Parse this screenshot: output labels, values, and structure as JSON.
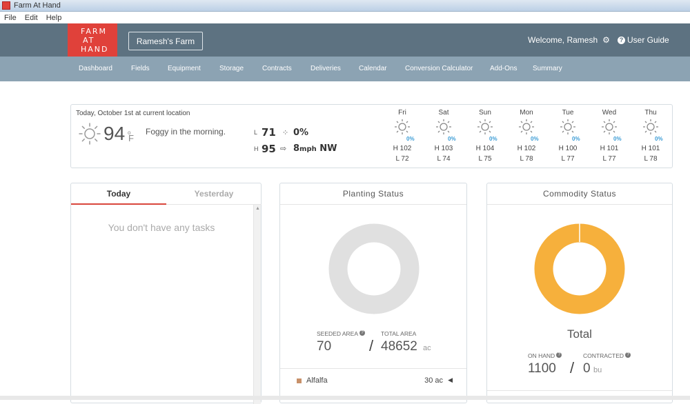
{
  "window": {
    "title": "Farm At Hand"
  },
  "menu": [
    "File",
    "Edit",
    "Help"
  ],
  "header": {
    "logo_lines": [
      "FARM",
      "AT",
      "HAND"
    ],
    "farm_name": "Ramesh's Farm",
    "welcome": "Welcome, Ramesh",
    "user_guide": "User Guide"
  },
  "nav": [
    "Dashboard",
    "Fields",
    "Equipment",
    "Storage",
    "Contracts",
    "Deliveries",
    "Calendar",
    "Conversion Calculator",
    "Add-Ons",
    "Summary"
  ],
  "weather": {
    "date_line": "Today, October 1st at current location",
    "temp": "94",
    "unit": "F",
    "description": "Foggy in the morning.",
    "low_label": "L",
    "low": "71",
    "high_label": "H",
    "high": "95",
    "precip": "0%",
    "wind_speed": "8",
    "wind_unit": "mph",
    "wind_dir": "NW",
    "forecast": [
      {
        "day": "Fri",
        "precip": "0%",
        "high": "H 102",
        "low": "L 72"
      },
      {
        "day": "Sat",
        "precip": "0%",
        "high": "H 103",
        "low": "L 74"
      },
      {
        "day": "Sun",
        "precip": "0%",
        "high": "H 104",
        "low": "L 75"
      },
      {
        "day": "Mon",
        "precip": "0%",
        "high": "H 102",
        "low": "L 78"
      },
      {
        "day": "Tue",
        "precip": "0%",
        "high": "H 100",
        "low": "L 77"
      },
      {
        "day": "Wed",
        "precip": "0%",
        "high": "H 101",
        "low": "L 77"
      },
      {
        "day": "Thu",
        "precip": "0%",
        "high": "H 101",
        "low": "L 78"
      }
    ]
  },
  "tasks": {
    "tab_today": "Today",
    "tab_yesterday": "Yesterday",
    "empty": "You don't have any tasks"
  },
  "planting": {
    "title": "Planting Status",
    "seeded_label": "SEEDED AREA",
    "total_label": "TOTAL AREA",
    "seeded": "70",
    "total": "48652",
    "unit": "ac",
    "crop": {
      "name": "Alfalfa",
      "area": "30 ac"
    },
    "ring_color": "#e0e0e0"
  },
  "commodity": {
    "title": "Commodity Status",
    "total_label": "Total",
    "on_hand_label": "ON HAND",
    "contracted_label": "CONTRACTED",
    "on_hand": "1100",
    "contracted": "0",
    "unit": "bu",
    "ring_color": "#f6b03c"
  },
  "colors": {
    "accent": "#e0413a",
    "header": "#5d7281",
    "nav": "#8ca3b3",
    "precip": "#3a9bd5"
  }
}
